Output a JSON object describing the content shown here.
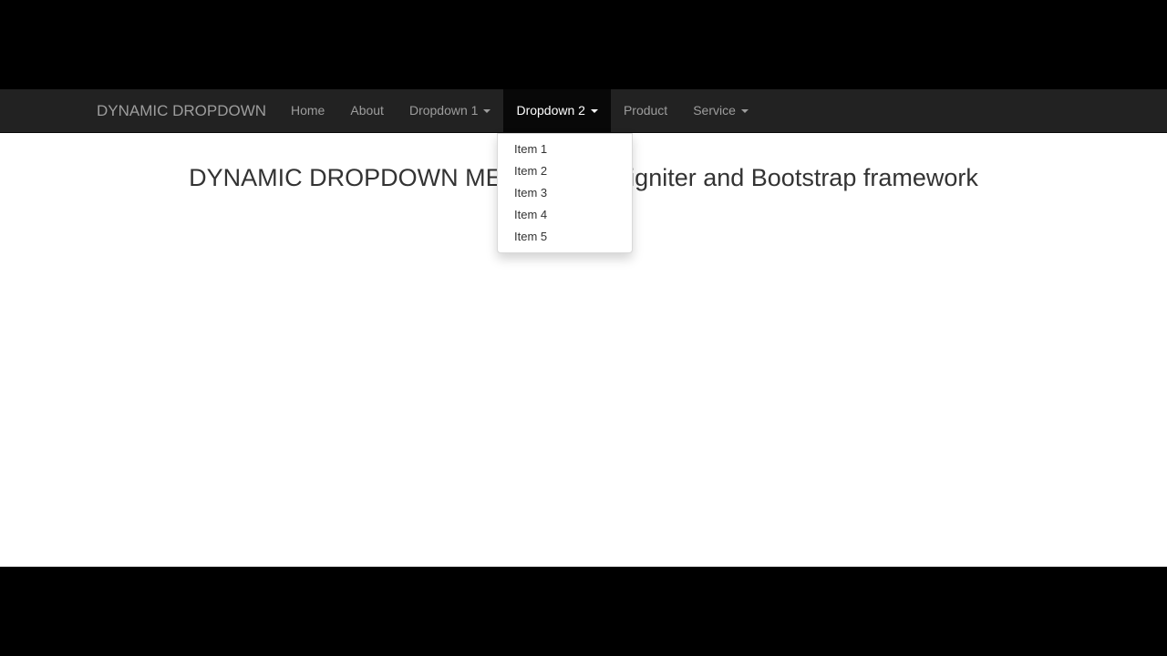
{
  "navbar": {
    "brand": "DYNAMIC DROPDOWN",
    "items": [
      {
        "label": "Home",
        "has_caret": false,
        "active": false
      },
      {
        "label": "About",
        "has_caret": false,
        "active": false
      },
      {
        "label": "Dropdown 1",
        "has_caret": true,
        "active": false
      },
      {
        "label": "Dropdown 2",
        "has_caret": true,
        "active": true
      },
      {
        "label": "Product",
        "has_caret": false,
        "active": false
      },
      {
        "label": "Service",
        "has_caret": true,
        "active": false
      }
    ]
  },
  "dropdown": {
    "items": [
      "Item 1",
      "Item 2",
      "Item 3",
      "Item 4",
      "Item 5"
    ]
  },
  "main": {
    "heading": "DYNAMIC DROPDOWN MENU in Codeigniter and Bootstrap framework"
  },
  "colors": {
    "navbar_bg": "#222222",
    "nav_text": "#9d9d9d",
    "nav_active_bg": "#080808",
    "nav_active_text": "#ffffff",
    "letterbox": "#000000"
  },
  "icons": {
    "caret": "caret-down-icon"
  }
}
